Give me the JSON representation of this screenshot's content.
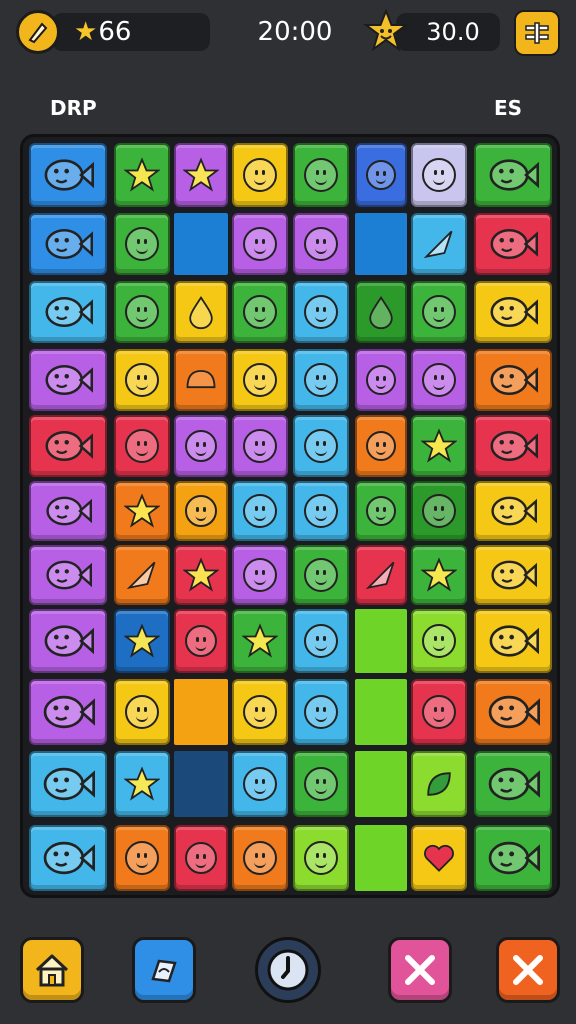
{
  "hud": {
    "coins": "66",
    "coin_prefix": "★",
    "timer": "20:00",
    "score": "30.0",
    "colors": {
      "gold": "#f2b51c",
      "pill": "#1e1f22"
    }
  },
  "labels": {
    "left": "DRP",
    "right": "ES"
  },
  "board": {
    "columns": 8,
    "rows": 11,
    "palette": {
      "blue": "#2f8fe6",
      "green": "#3cb33a",
      "purple": "#b760e6",
      "yellow": "#f5c816",
      "sky": "#44b7ea",
      "red": "#e6344e",
      "orange": "#f07a1c",
      "lime": "#8bdc2e",
      "pink": "#c45fe0",
      "indigo": "#3a6de0",
      "lav": "#c8c6ee",
      "teal": "#2aa64a",
      "darkblue": "#1e6fc4",
      "deepgreen": "#2c9a2a",
      "gapblue": "#1d7fd3",
      "gapgreen": "#6fd428",
      "gapnavy": "#1b4a7a",
      "gaporange": "#f4a112"
    },
    "tiles": [
      [
        "blue:fish",
        "green:star",
        "purple:star",
        "yellow:face",
        "green:face",
        "indigo:face",
        "lav:face",
        "green:fish"
      ],
      [
        "blue:fish",
        "green:face",
        "gapblue:gap",
        "purple:face",
        "purple:face",
        "gapblue:gap",
        "sky:kite",
        "red:fish"
      ],
      [
        "sky:fish",
        "green:face",
        "yellow:drop",
        "green:face",
        "sky:face",
        "deepgreen:drop",
        "green:face",
        "yellow:fish"
      ],
      [
        "purple:fish",
        "yellow:face",
        "orange:bun",
        "yellow:face",
        "sky:face",
        "purple:face",
        "purple:face",
        "orange:fish"
      ],
      [
        "red:fish",
        "red:face",
        "purple:face",
        "purple:face",
        "sky:face",
        "orange:face",
        "green:star",
        "red:fish"
      ],
      [
        "purple:fish",
        "orange:star",
        "gaporange:face",
        "sky:face",
        "sky:face",
        "green:face",
        "deepgreen:face",
        "yellow:fish"
      ],
      [
        "purple:fish",
        "orange:kite",
        "red:star",
        "purple:face",
        "green:face",
        "red:kite",
        "green:star",
        "yellow:fish"
      ],
      [
        "purple:fish",
        "darkblue:star",
        "red:face",
        "green:star",
        "sky:face",
        "gapgreen:gap",
        "lime:face",
        "yellow:fish"
      ],
      [
        "purple:fish",
        "yellow:face",
        "gaporange:gap",
        "yellow:face",
        "sky:face",
        "gapgreen:gap",
        "red:face",
        "orange:fish"
      ],
      [
        "sky:fish",
        "sky:star",
        "gapnavy:gap",
        "sky:face",
        "green:face",
        "gapgreen:gap",
        "lime:leaf",
        "green:fish"
      ],
      [
        "sky:fish",
        "orange:face",
        "red:face",
        "orange:face",
        "lime:face",
        "gapgreen:gap",
        "yellow:heart",
        "green:fish"
      ]
    ]
  },
  "bottom_bar": {
    "buttons": [
      {
        "name": "home-button",
        "icon": "home-icon",
        "color": "#f2b51c"
      },
      {
        "name": "hint-button",
        "icon": "shuffle-icon",
        "color": "#2f8fe6"
      },
      {
        "name": "pause-button",
        "icon": "clock-icon",
        "color": "#2c3d5a"
      },
      {
        "name": "remove-button",
        "icon": "x-icon",
        "color": "#e2549a"
      },
      {
        "name": "close-button",
        "icon": "x-icon",
        "color": "#f06220"
      }
    ]
  }
}
